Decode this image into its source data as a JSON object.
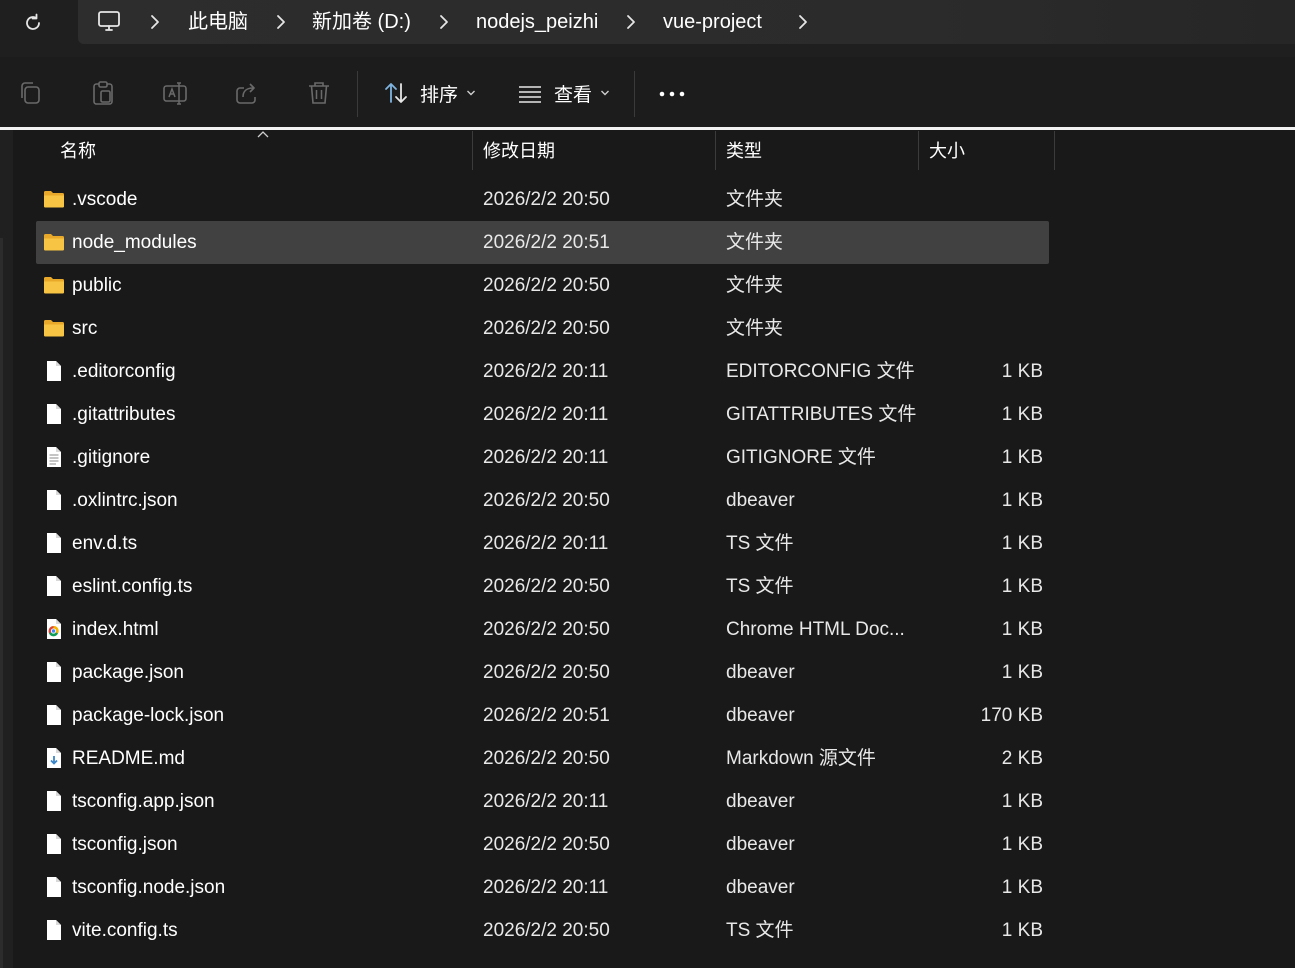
{
  "breadcrumb": {
    "items": [
      "此电脑",
      "新加卷 (D:)",
      "nodejs_peizhi",
      "vue-project"
    ]
  },
  "toolbar": {
    "sort_label": "排序",
    "view_label": "查看"
  },
  "columns": {
    "name": "名称",
    "date": "修改日期",
    "type": "类型",
    "size": "大小"
  },
  "files": [
    {
      "name": ".vscode",
      "date": "2026/2/2 20:50",
      "type": "文件夹",
      "size": "",
      "icon": "folder-icon"
    },
    {
      "name": "node_modules",
      "date": "2026/2/2 20:51",
      "type": "文件夹",
      "size": "",
      "icon": "folder-icon",
      "selected": true
    },
    {
      "name": "public",
      "date": "2026/2/2 20:50",
      "type": "文件夹",
      "size": "",
      "icon": "folder-icon"
    },
    {
      "name": "src",
      "date": "2026/2/2 20:50",
      "type": "文件夹",
      "size": "",
      "icon": "folder-icon"
    },
    {
      "name": ".editorconfig",
      "date": "2026/2/2 20:11",
      "type": "EDITORCONFIG 文件",
      "size": "1 KB",
      "icon": "file-icon"
    },
    {
      "name": ".gitattributes",
      "date": "2026/2/2 20:11",
      "type": "GITATTRIBUTES 文件",
      "size": "1 KB",
      "icon": "file-icon"
    },
    {
      "name": ".gitignore",
      "date": "2026/2/2 20:11",
      "type": "GITIGNORE 文件",
      "size": "1 KB",
      "icon": "text-file-icon"
    },
    {
      "name": ".oxlintrc.json",
      "date": "2026/2/2 20:50",
      "type": "dbeaver",
      "size": "1 KB",
      "icon": "file-icon"
    },
    {
      "name": "env.d.ts",
      "date": "2026/2/2 20:11",
      "type": "TS 文件",
      "size": "1 KB",
      "icon": "file-icon"
    },
    {
      "name": "eslint.config.ts",
      "date": "2026/2/2 20:50",
      "type": "TS 文件",
      "size": "1 KB",
      "icon": "file-icon"
    },
    {
      "name": "index.html",
      "date": "2026/2/2 20:50",
      "type": "Chrome HTML Doc...",
      "size": "1 KB",
      "icon": "chrome-file-icon"
    },
    {
      "name": "package.json",
      "date": "2026/2/2 20:50",
      "type": "dbeaver",
      "size": "1 KB",
      "icon": "file-icon"
    },
    {
      "name": "package-lock.json",
      "date": "2026/2/2 20:51",
      "type": "dbeaver",
      "size": "170 KB",
      "icon": "file-icon"
    },
    {
      "name": "README.md",
      "date": "2026/2/2 20:50",
      "type": "Markdown 源文件",
      "size": "2 KB",
      "icon": "markdown-file-icon"
    },
    {
      "name": "tsconfig.app.json",
      "date": "2026/2/2 20:11",
      "type": "dbeaver",
      "size": "1 KB",
      "icon": "file-icon"
    },
    {
      "name": "tsconfig.json",
      "date": "2026/2/2 20:50",
      "type": "dbeaver",
      "size": "1 KB",
      "icon": "file-icon"
    },
    {
      "name": "tsconfig.node.json",
      "date": "2026/2/2 20:11",
      "type": "dbeaver",
      "size": "1 KB",
      "icon": "file-icon"
    },
    {
      "name": "vite.config.ts",
      "date": "2026/2/2 20:50",
      "type": "TS 文件",
      "size": "1 KB",
      "icon": "file-icon"
    }
  ],
  "colors": {
    "background": "#191919",
    "selected_row": "#414141",
    "folder": "#f7c543",
    "text": "#ffffff"
  }
}
